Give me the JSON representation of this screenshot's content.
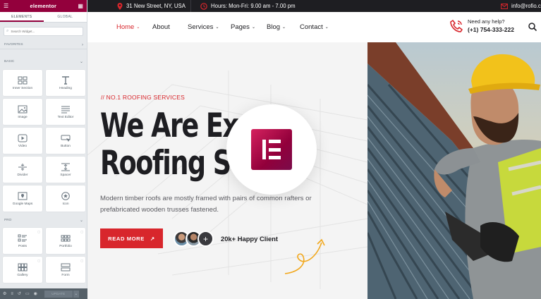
{
  "panel": {
    "logo": "elementor",
    "tabs": [
      "ELEMENTS",
      "GLOBAL"
    ],
    "search_placeholder": "Search Widget...",
    "categories": {
      "favorites": "FAVORITES",
      "basic": "BASIC",
      "pro": "PRO"
    },
    "basic_widgets": [
      {
        "label": "Inner Section",
        "icon": "inner-section-icon"
      },
      {
        "label": "Heading",
        "icon": "heading-icon"
      },
      {
        "label": "Image",
        "icon": "image-icon"
      },
      {
        "label": "Text Editor",
        "icon": "text-editor-icon"
      },
      {
        "label": "Video",
        "icon": "video-icon"
      },
      {
        "label": "Button",
        "icon": "button-icon"
      },
      {
        "label": "Divider",
        "icon": "divider-icon"
      },
      {
        "label": "Spacer",
        "icon": "spacer-icon"
      },
      {
        "label": "Google Maps",
        "icon": "map-icon"
      },
      {
        "label": "Icon",
        "icon": "star-icon"
      }
    ],
    "pro_widgets": [
      {
        "label": "Posts",
        "icon": "posts-icon"
      },
      {
        "label": "Portfolio",
        "icon": "portfolio-icon"
      },
      {
        "label": "Gallery",
        "icon": "gallery-icon"
      },
      {
        "label": "Form",
        "icon": "form-icon"
      }
    ],
    "update_label": "UPDATE"
  },
  "topbar": {
    "address": "31 New Street, NY, USA",
    "hours": "Hours: Mon-Fri: 9.00 am - 7.00 pm",
    "email": "info@rofio.c"
  },
  "nav": {
    "items": [
      "Home",
      "About",
      "Services",
      "Pages",
      "Blog",
      "Contact"
    ],
    "help_label": "Need any help?",
    "phone": "(+1) 754-333-222"
  },
  "hero": {
    "tagline": "// NO.1 ROOFING SERVICES",
    "headline_line1": "We Are Exp",
    "headline_line2": "Roofing Se",
    "description": "Modern timber roofs are mostly framed with pairs of common rafters or prefabricated wooden trusses fastened.",
    "button_label": "READ MORE",
    "happy_clients": "20k+ Happy Client",
    "plus": "+"
  },
  "colors": {
    "accent": "#d8262c",
    "elementor": "#93003c",
    "dark": "#1e1e22"
  }
}
